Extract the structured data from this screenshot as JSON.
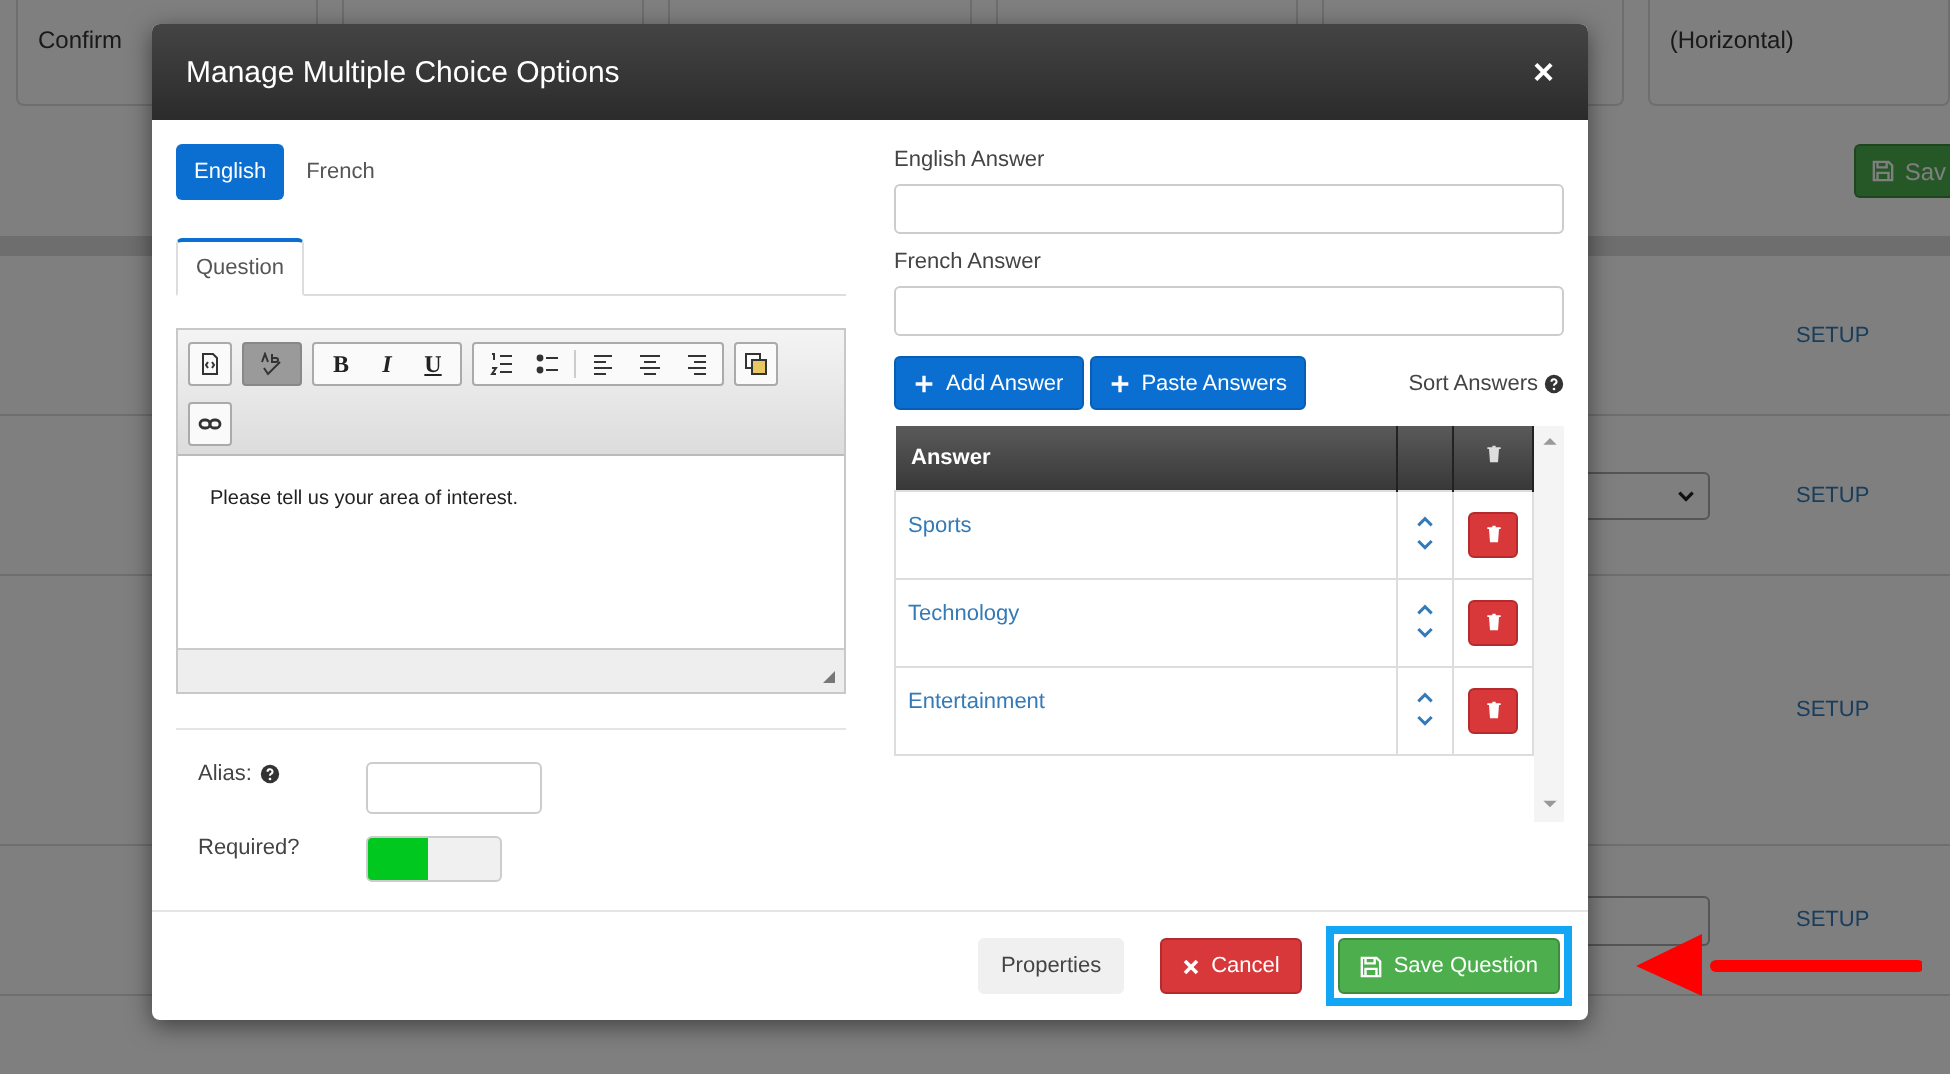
{
  "background": {
    "header_cells": [
      {
        "lines": [
          "Confirm"
        ]
      },
      {},
      {},
      {},
      {},
      {
        "lines": [
          "(Horizontal)"
        ]
      }
    ],
    "save_button": "Sav",
    "rows": [
      {
        "kind": "plain",
        "link": "SETUP"
      },
      {
        "kind": "select",
        "link": "SETUP"
      },
      {
        "kind": "plain",
        "link": "SETUP"
      },
      {
        "kind": "input",
        "link": "SETUP"
      }
    ]
  },
  "modal": {
    "title": "Manage Multiple Choice Options",
    "close": "×",
    "language_tabs": [
      {
        "label": "English",
        "selected": true
      },
      {
        "label": "French",
        "selected": false
      }
    ],
    "editor_tabs": [
      {
        "label": "Question",
        "selected": true
      }
    ],
    "toolbar": [
      {
        "kind": "source",
        "pressed": false
      },
      {
        "kind": "spellcheck",
        "pressed": true
      },
      {
        "kind": "bold",
        "label": "B",
        "pressed": false
      },
      {
        "kind": "italic",
        "label": "I",
        "pressed": false
      },
      {
        "kind": "underline",
        "label": "U",
        "pressed": false
      },
      {
        "kind": "ordered-list",
        "pressed": false
      },
      {
        "kind": "bullet-list",
        "pressed": false
      },
      {
        "kind": "align-left",
        "pressed": false
      },
      {
        "kind": "align-center",
        "pressed": false
      },
      {
        "kind": "align-right",
        "pressed": false
      },
      {
        "kind": "image",
        "pressed": false
      },
      {
        "kind": "link",
        "pressed": false
      }
    ],
    "content": "Please tell us your area of interest.",
    "alias": {
      "label": "Alias:"
    },
    "required": {
      "label": "Required?",
      "on": true
    },
    "english_answer": {
      "label": "English Answer"
    },
    "french_answer": {
      "label": "French Answer"
    },
    "add_answer": "Add Answer",
    "paste_answers": "Paste Answers",
    "sort_answers": "Sort Answers",
    "table": {
      "columns": [
        "Answer"
      ],
      "rows": [
        {
          "answer": "Sports"
        },
        {
          "answer": "Technology"
        },
        {
          "answer": "Entertainment"
        }
      ]
    },
    "footer": [
      {
        "kind": "default",
        "label": "Properties",
        "highlighted": false
      },
      {
        "kind": "cancel",
        "label": "Cancel",
        "highlighted": false
      },
      {
        "kind": "save",
        "label": "Save Question",
        "highlighted": true
      }
    ]
  }
}
